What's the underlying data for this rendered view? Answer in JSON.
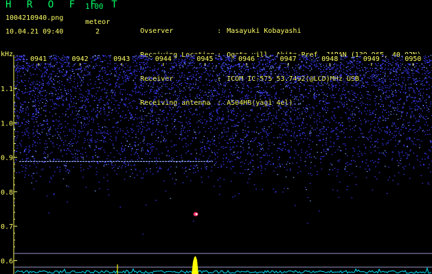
{
  "header": {
    "app_title": "H R O F F T",
    "app_version": "1.00",
    "file_name": "1004210940.png",
    "datetime": "10.04.21 09:40",
    "meteor_label": "meteor",
    "meteor_count": "2",
    "info": [
      {
        "key": "Ovserver",
        "value": "Masayuki Kobayashi"
      },
      {
        "key": "Receiving Location",
        "value": "Ogata-vill. Akita-Pref. JAPAN (139.96E, 40.02N)"
      },
      {
        "key": "Receiver",
        "value": "ICOM IC-575 53.7492(@LCD)MHz USB"
      },
      {
        "key": "Receiving antenna",
        "value": "A504HB(yagi 4el)"
      }
    ],
    "separator": ":"
  },
  "chart_data": {
    "type": "heatmap",
    "ylabel": "kHz",
    "x_ticks": [
      "0941",
      "0942",
      "0943",
      "0944",
      "0945",
      "0946",
      "0947",
      "0948",
      "0949",
      "0950"
    ],
    "y_ticks": [
      "1.1",
      "1.0",
      "0.9",
      "0.8",
      "0.7",
      "0.6"
    ],
    "y_tick_values": [
      1.1,
      1.0,
      0.9,
      0.8,
      0.7,
      0.6
    ],
    "colors": {
      "background": "#000000",
      "axis": "#ffff66",
      "noise": "#3a3aff",
      "noise_bright": "#7fa8ff",
      "carrier_line": "#8fa8ff",
      "echo": "#ff3366",
      "spectrum": "#00e5ff",
      "spike": "#ffff00",
      "guide_line": "#9999cc"
    }
  }
}
